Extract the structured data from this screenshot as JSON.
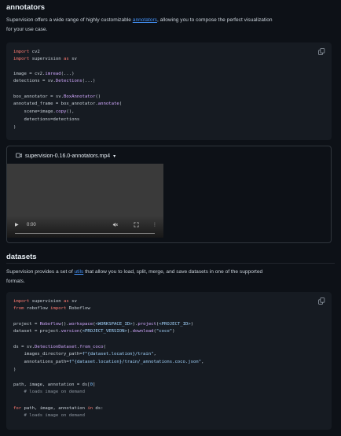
{
  "annotators": {
    "heading": "annotators",
    "intro_before": "Supervision offers a wide range of highly customizable ",
    "intro_link": "annotators",
    "intro_after": ", allowing you to compose the perfect visualization",
    "intro_line2": "for your use case."
  },
  "video": {
    "filename": "supervision-0.16.0-annotators.mp4",
    "time": "0:00"
  },
  "datasets": {
    "heading": "datasets",
    "intro_before": "Supervision provides a set of ",
    "intro_link": "utils",
    "intro_after": " that allow you to load, split, merge, and save datasets in one of the supported",
    "intro_line2": "formats."
  },
  "icons": {
    "copy": "copy-icon",
    "video": "video-icon",
    "caret": "caret-down-icon",
    "play": "play-icon",
    "mute": "mute-icon",
    "fullscreen": "fullscreen-icon",
    "more": "more-icon"
  }
}
